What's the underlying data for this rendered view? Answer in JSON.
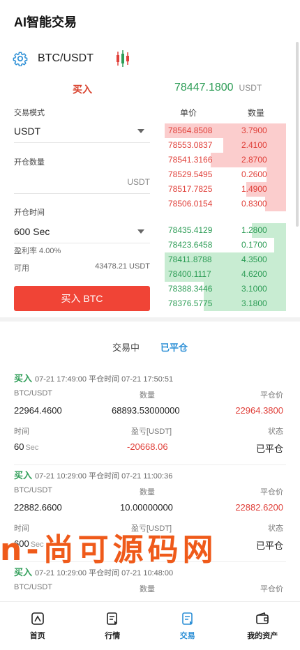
{
  "header": {
    "title": "AI智能交易"
  },
  "pair": {
    "name": "BTC/USDT",
    "settings_icon": "gear-icon",
    "chart_icon": "candlestick-icon"
  },
  "form": {
    "buy_tab": "买入",
    "mode_label": "交易模式",
    "mode_value": "USDT",
    "qty_label": "开仓数量",
    "qty_unit": "USDT",
    "time_label": "开仓时间",
    "time_value": "600 Sec",
    "profit_rate": "盈利率 4.00%",
    "available_label": "可用",
    "available_value": "43478.21 USDT",
    "buy_button": "买入 BTC"
  },
  "orderbook": {
    "last_price": "78447.1800",
    "last_unit": "USDT",
    "price_header": "单价",
    "amount_header": "数量",
    "asks": [
      {
        "price": "78564.8508",
        "amount": "3.7900",
        "depth": 1.0
      },
      {
        "price": "78553.0837",
        "amount": "2.4100",
        "depth": 0.52
      },
      {
        "price": "78541.3166",
        "amount": "2.8700",
        "depth": 0.62
      },
      {
        "price": "78529.5495",
        "amount": "0.2600",
        "depth": 0.16
      },
      {
        "price": "78517.7825",
        "amount": "1.4900",
        "depth": 0.33
      },
      {
        "price": "78506.0154",
        "amount": "0.8300",
        "depth": 0.17
      }
    ],
    "bids": [
      {
        "price": "78435.4129",
        "amount": "1.2800",
        "depth": 0.28
      },
      {
        "price": "78423.6458",
        "amount": "0.1700",
        "depth": 0.1
      },
      {
        "price": "78411.8788",
        "amount": "4.3500",
        "depth": 1.0
      },
      {
        "price": "78400.1117",
        "amount": "4.6200",
        "depth": 1.0
      },
      {
        "price": "78388.3446",
        "amount": "3.1000",
        "depth": 0.68
      },
      {
        "price": "78376.5775",
        "amount": "3.1800",
        "depth": 0.68
      }
    ]
  },
  "tabs": {
    "open": "交易中",
    "closed": "已平仓"
  },
  "records": [
    {
      "side": "买入",
      "head": "07-21 17:49:00 平仓时间 07-21 17:50:51",
      "pair_label": "BTC/USDT",
      "amount_label": "数量",
      "close_label": "平仓价",
      "open_price": "22964.4600",
      "amount": "68893.53000000",
      "close_price": "22964.3800",
      "time_label": "时间",
      "pnl_label": "盈亏[USDT]",
      "status_label": "状态",
      "time_value": "60",
      "time_unit": "Sec",
      "pnl": "-20668.06",
      "status": "已平仓"
    },
    {
      "side": "买入",
      "head": "07-21 10:29:00 平仓时间 07-21 11:00:36",
      "pair_label": "BTC/USDT",
      "amount_label": "数量",
      "close_label": "平仓价",
      "open_price": "22882.6600",
      "amount": "10.00000000",
      "close_price": "22882.6200",
      "time_label": "时间",
      "pnl_label": "盈亏[USDT]",
      "status_label": "状态",
      "time_value": "600",
      "time_unit": "Sec",
      "pnl": "",
      "status": "已平仓"
    },
    {
      "side": "买入",
      "head": "07-21 10:29:00 平仓时间 07-21 10:48:00",
      "pair_label": "BTC/USDT",
      "amount_label": "数量",
      "close_label": "平仓价",
      "open_price": "",
      "amount": "",
      "close_price": "",
      "time_label": "",
      "pnl_label": "",
      "status_label": "",
      "time_value": "",
      "time_unit": "",
      "pnl": "",
      "status": ""
    }
  ],
  "watermark": "n-尚可源码网",
  "nav": [
    {
      "label": "首页",
      "icon": "home-icon"
    },
    {
      "label": "行情",
      "icon": "market-icon"
    },
    {
      "label": "交易",
      "icon": "trade-icon"
    },
    {
      "label": "我的资产",
      "icon": "wallet-icon"
    }
  ]
}
